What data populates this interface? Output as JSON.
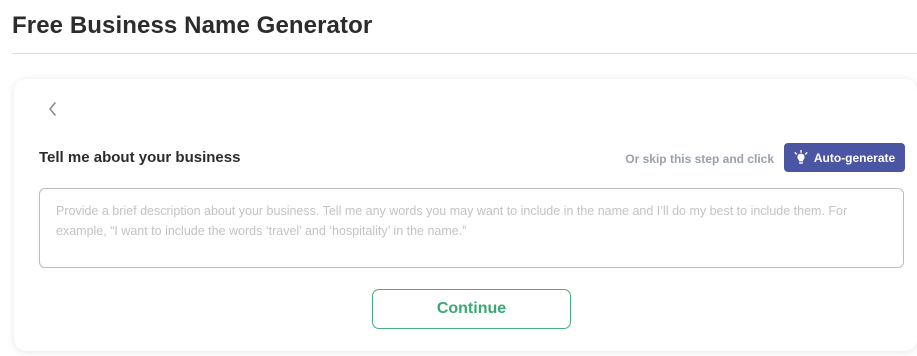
{
  "header": {
    "title": "Free Business Name Generator"
  },
  "card": {
    "back_icon": "chevron-left-icon",
    "heading": "Tell me about your business",
    "skip_text": "Or skip this step and click",
    "autogen": {
      "icon": "lightbulb-icon",
      "label": "Auto-generate"
    },
    "description": {
      "value": "",
      "placeholder": "Provide a brief description about your business. Tell me any words you may want to include in the name and I’ll do my best to include them. For example, “I want to include the words ‘travel’ and ‘hospitality’ in the name.”"
    },
    "continue_label": "Continue"
  },
  "colors": {
    "autogen_bg": "#4a56a4",
    "continue_accent": "#3aa873",
    "muted_text": "#9aa0ad"
  }
}
